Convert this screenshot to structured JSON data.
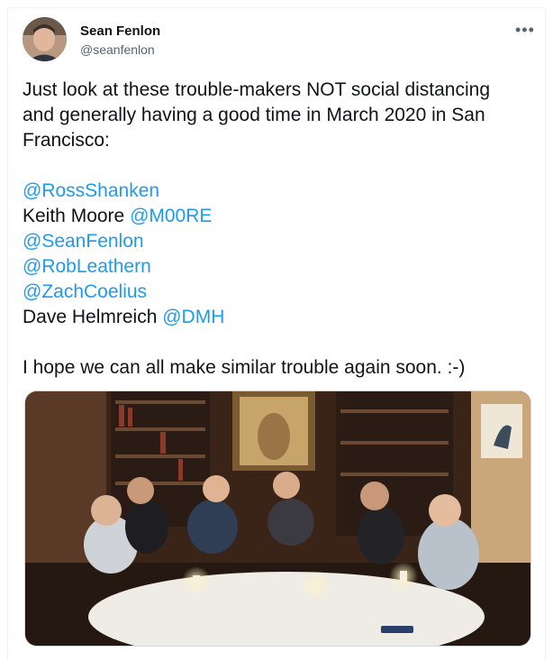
{
  "tweet": {
    "author_name": "Sean Fenlon",
    "author_handle": "@seanfenlon",
    "more_icon": "more-horizontal-icon",
    "text_line_1": "Just look at these trouble-makers NOT social distancing",
    "text_line_2": "and generally having a good time in March 2020 in San",
    "text_line_3": "Francisco:",
    "mentions": [
      {
        "prefix": "",
        "mention": "@RossShanken"
      },
      {
        "prefix": "Keith Moore ",
        "mention": "@M00RE"
      },
      {
        "prefix": "",
        "mention": "@SeanFenlon"
      },
      {
        "prefix": "",
        "mention": "@RobLeathern"
      },
      {
        "prefix": "",
        "mention": "@ZachCoelius"
      },
      {
        "prefix": "Dave Helmreich ",
        "mention": "@DMH"
      }
    ],
    "closing": "I hope we can all make similar trouble again soon. :-)"
  },
  "colors": {
    "link": "#1d9bf0",
    "text": "#0f1419",
    "secondary": "#536471"
  }
}
